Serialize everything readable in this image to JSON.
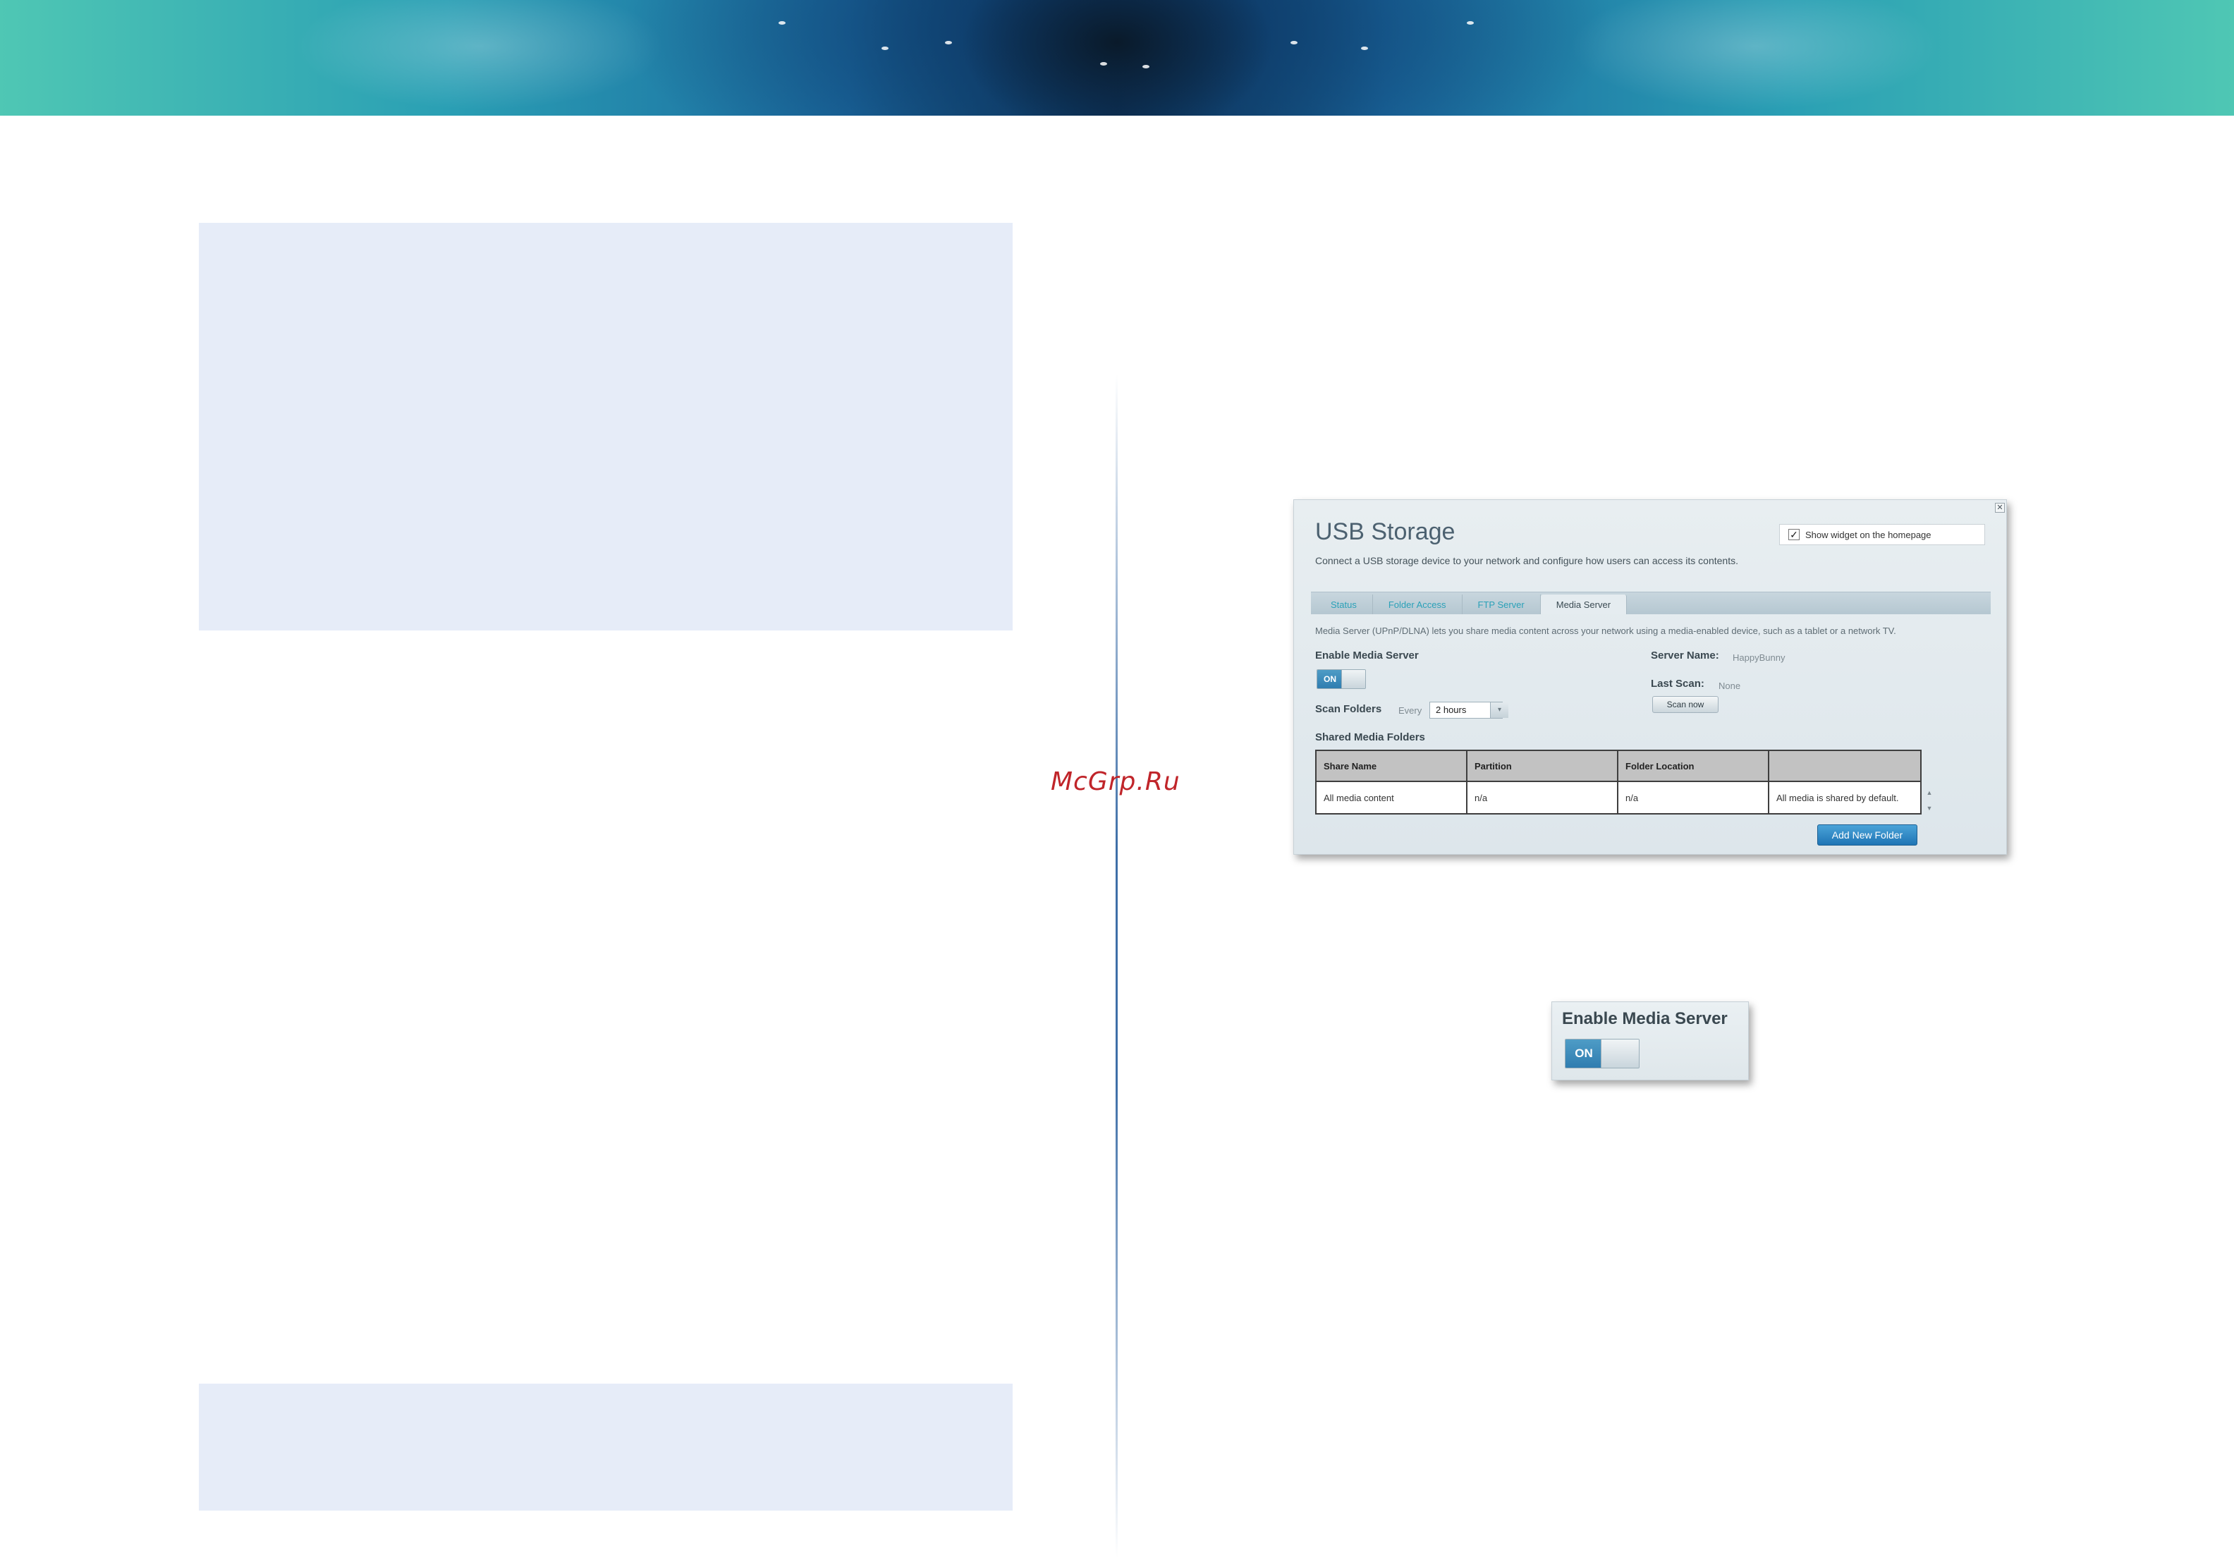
{
  "widget": {
    "title": "USB Storage",
    "description": "Connect a USB storage device to your network and configure how users can access its contents.",
    "show_widget_label": "Show widget on the homepage",
    "show_widget_checked": true,
    "close_glyph": "✕",
    "tabs": [
      {
        "label": "Status",
        "active": false
      },
      {
        "label": "Folder Access",
        "active": false
      },
      {
        "label": "FTP Server",
        "active": false
      },
      {
        "label": "Media Server",
        "active": true
      }
    ],
    "info": "Media Server (UPnP/DLNA) lets you share media content across your network using a media-enabled device, such as a tablet or a network TV.",
    "enable_label": "Enable Media Server",
    "toggle_on": "ON",
    "scan_folders_label": "Scan Folders",
    "every_label": "Every",
    "scan_interval": "2 hours",
    "server_name_label": "Server Name:",
    "server_name_value": "HappyBunny",
    "last_scan_label": "Last Scan:",
    "last_scan_value": "None",
    "scan_now_label": "Scan now",
    "shared_folders_label": "Shared Media Folders",
    "table": {
      "headers": [
        "Share Name",
        "Partition",
        "Folder Location",
        ""
      ],
      "rows": [
        [
          "All media content",
          "n/a",
          "n/a",
          "All media is shared by default."
        ]
      ]
    },
    "add_folder_label": "Add New Folder"
  },
  "zoom": {
    "enable_label": "Enable Media Server",
    "toggle_on": "ON"
  },
  "watermark": "McGrp.Ru",
  "colors": {
    "panel": "#e6ecf8",
    "divider": "#3e6fa8",
    "accent": "#2f7db0",
    "watermark": "#c0252a"
  }
}
